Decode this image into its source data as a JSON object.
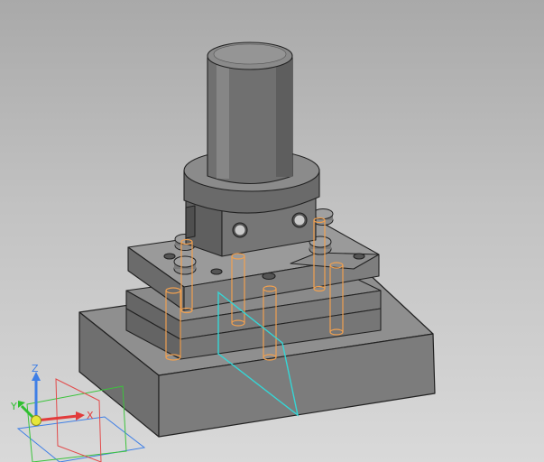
{
  "app": {
    "view": "3d-model-viewport"
  },
  "axis_triad": {
    "x_label": "X",
    "y_label": "Y",
    "z_label": "Z",
    "x_color": "#e23b3b",
    "y_color": "#2fbf2f",
    "z_color": "#3f7fe6",
    "origin_color": "#e6e63a"
  },
  "colors": {
    "background_top": "#a9a9a9",
    "background_bottom": "#d9d9d9",
    "body_light": "#9a9a9a",
    "body_mid": "#7a7a7a",
    "body_dark": "#5f5f5f",
    "edge": "#222222",
    "hidden_pin": "#f0a050",
    "section_plane": "#35d6d6"
  },
  "model": {
    "parts": [
      "base-block",
      "lower-plate",
      "upper-plate",
      "clamp-block",
      "cylinder-shaft",
      "guide-pins",
      "section-plane"
    ]
  }
}
